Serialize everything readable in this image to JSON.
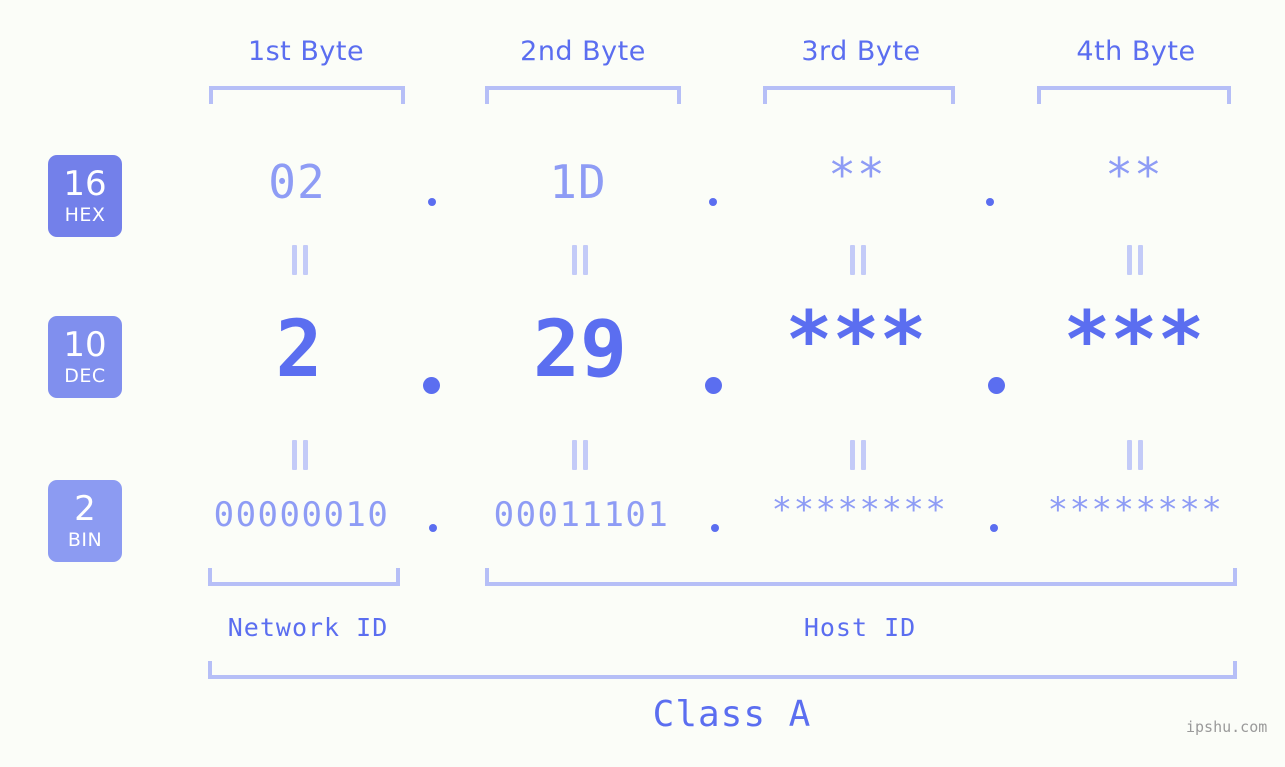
{
  "background_color": "#fbfdf8",
  "accent_color": "#5b6ef0",
  "light_accent_color": "#b6bff7",
  "byte_headers": [
    {
      "label": "1st Byte"
    },
    {
      "label": "2nd Byte"
    },
    {
      "label": "3rd Byte"
    },
    {
      "label": "4th Byte"
    }
  ],
  "rows": [
    {
      "badge": {
        "base": "16",
        "name": "HEX",
        "color": "#7380ea"
      },
      "values": [
        "02",
        "1D",
        "**",
        "**"
      ],
      "separator": "."
    },
    {
      "badge": {
        "base": "10",
        "name": "DEC",
        "color": "#808fee"
      },
      "values": [
        "2",
        "29",
        "***",
        "***"
      ],
      "separator": "."
    },
    {
      "badge": {
        "base": "2",
        "name": "BIN",
        "color": "#8c9bf2"
      },
      "values": [
        "00000010",
        "00011101",
        "********",
        "********"
      ],
      "separator": "."
    }
  ],
  "segments": {
    "network_id": "Network ID",
    "host_id": "Host ID"
  },
  "class_label": "Class A",
  "watermark": "ipshu.com"
}
